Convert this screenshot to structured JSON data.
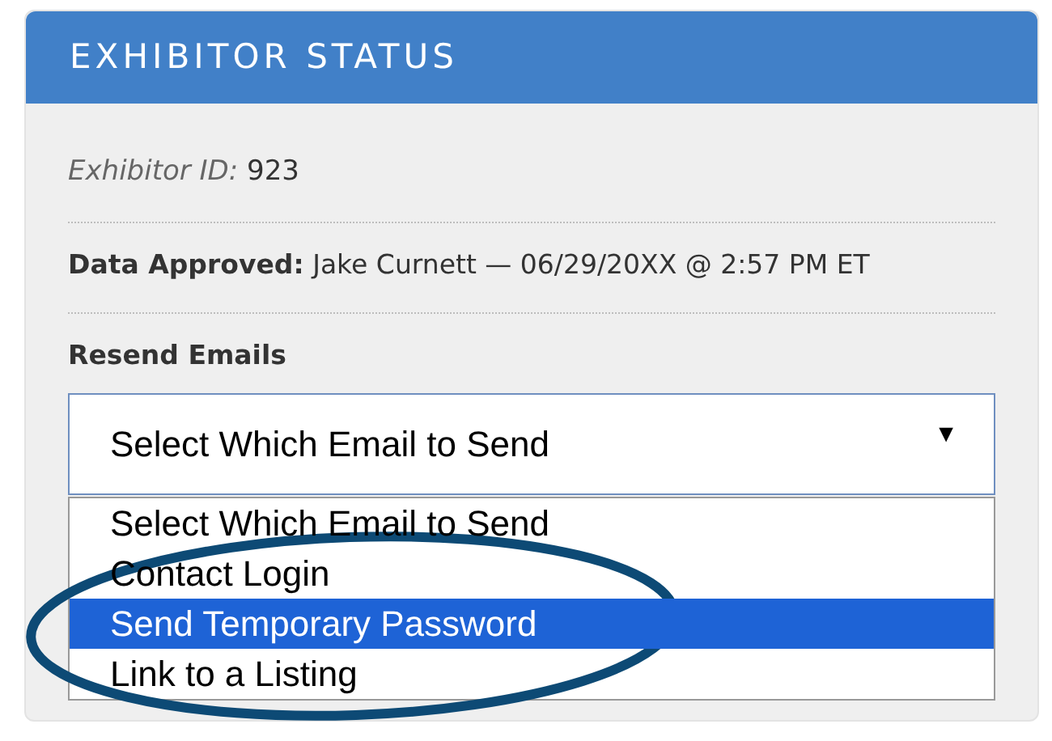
{
  "panel": {
    "title": "EXHIBITOR STATUS"
  },
  "exhibitor_id": {
    "label": "Exhibitor ID:",
    "value": "923"
  },
  "data_approved": {
    "label": "Data Approved:",
    "value": "Jake Curnett — 06/29/20XX @ 2:57 PM ET"
  },
  "resend_emails": {
    "label": "Resend Emails",
    "select": {
      "value": "Select Which Email to Send",
      "caret": "▼",
      "expanded": true
    },
    "options": [
      {
        "label": "Select Which Email to Send",
        "selected": false
      },
      {
        "label": "Contact Login",
        "selected": false
      },
      {
        "label": "Send Temporary Password",
        "selected": true
      },
      {
        "label": "Link to a Listing",
        "selected": false
      }
    ]
  }
}
